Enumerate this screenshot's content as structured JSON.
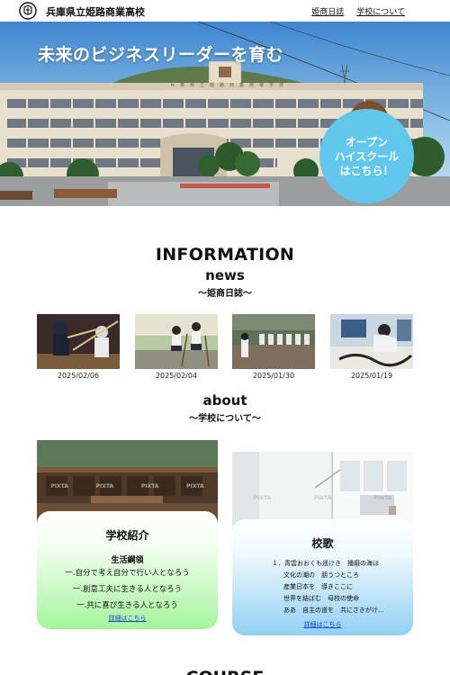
{
  "header": {
    "site_title": "兵庫県立姫路商業高校",
    "nav": [
      {
        "label": "姫商日誌"
      },
      {
        "label": "学校について"
      }
    ]
  },
  "hero": {
    "title": "未来のビジネスリーダーを育む",
    "building_sign": "兵庫県立姫路商業高等学校",
    "open_campus": {
      "line1": "オープン",
      "line2": "ハイスクール",
      "line3": "はこちら！"
    }
  },
  "information": {
    "heading": "INFORMATION",
    "news_title": "news",
    "news_caption": "～姫商日誌～",
    "news_items": [
      {
        "date": "2025/02/06",
        "image": "kendo-icon"
      },
      {
        "date": "2025/02/04",
        "image": "cleaning-icon"
      },
      {
        "date": "2025/01/30",
        "image": "baseball-icon"
      },
      {
        "date": "2025/01/19",
        "image": "calligraphy-icon"
      }
    ]
  },
  "about": {
    "title": "about",
    "caption": "～学校について～",
    "school_card": {
      "title": "学校紹介",
      "subtitle": "生活綱領",
      "lines": [
        "一.自分で考え自分で行い人となろう",
        "一.創意工夫に生きる人となろう",
        "一.共に喜び生きる人となろう"
      ],
      "link": "詳細はこちら",
      "watermark": "PIXTA"
    },
    "song_card": {
      "title": "校歌",
      "lines": [
        "１．青雲おおくも遥けき　播磨の海は",
        "文化の潮の　朋うつところ",
        "産業日本を　導きここに",
        "世界を結ばむ　母校の使命",
        "ああ　自主の道を　共にさきがけ..."
      ],
      "link": "詳細はこちら",
      "watermark": "PIXTA"
    }
  },
  "course": {
    "heading": "COURSE"
  },
  "colors": {
    "accent_blue": "#62c7ec",
    "card_green_bottom": "#a4f59a",
    "card_blue_bottom": "#8fd1f3",
    "link": "#1a3fd6"
  }
}
